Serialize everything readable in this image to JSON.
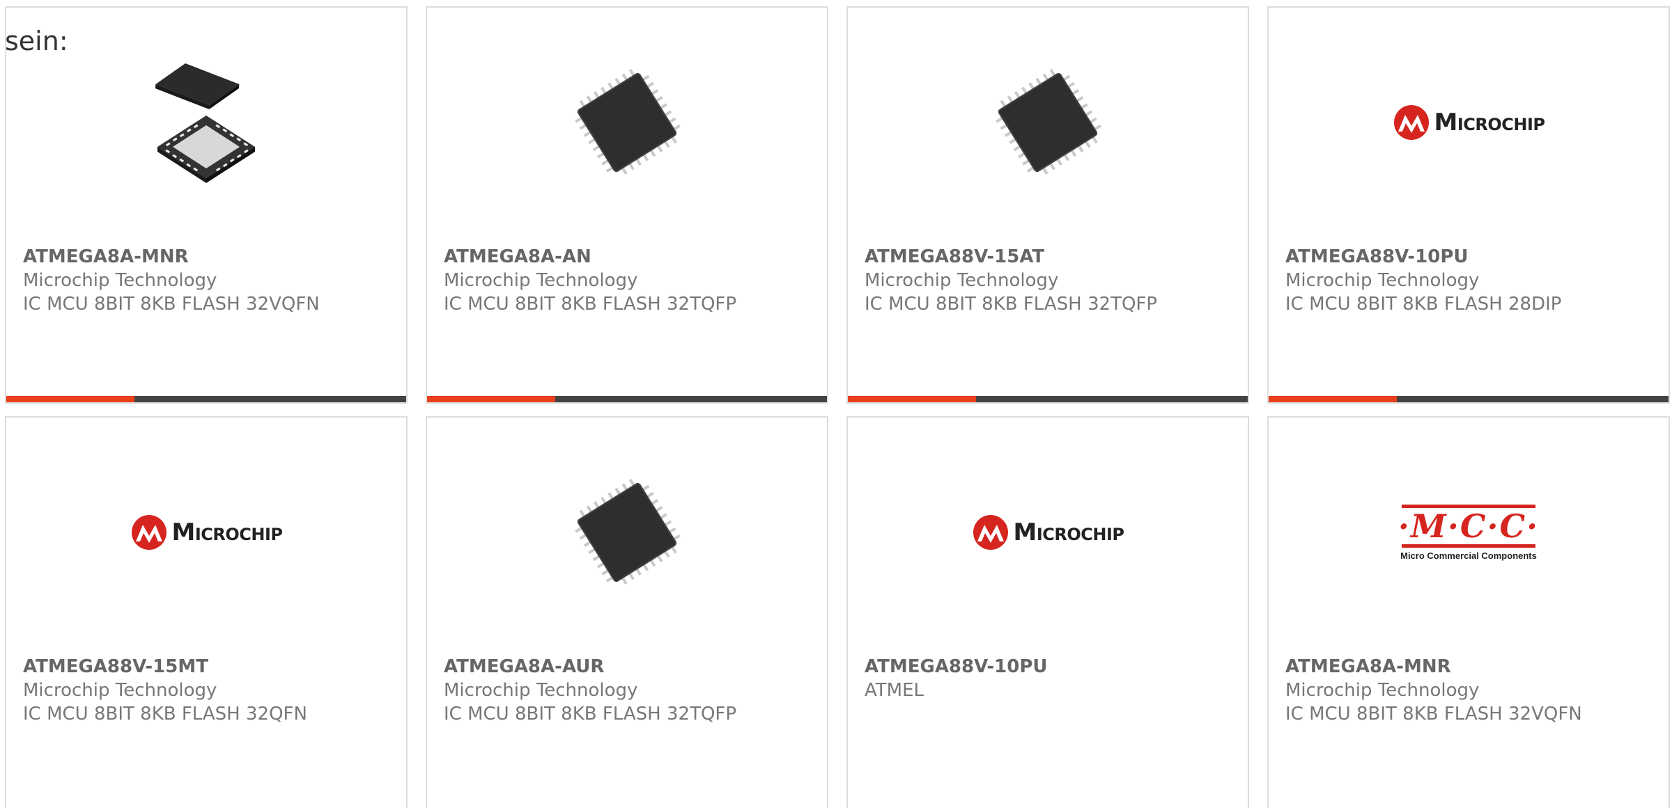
{
  "intro_text": "sein:",
  "colors": {
    "accent": "#e8401c",
    "bar": "#444444",
    "microchip_red": "#d6241e",
    "border": "#dddddd"
  },
  "products": [
    {
      "part": "ATMEGA8A-MNR",
      "manufacturer": "Microchip Technology",
      "description": "IC MCU 8BIT 8KB FLASH 32VQFN",
      "image": "qfn-chip-pair"
    },
    {
      "part": "ATMEGA8A-AN",
      "manufacturer": "Microchip Technology",
      "description": "IC MCU 8BIT 8KB FLASH 32TQFP",
      "image": "tqfp-chip"
    },
    {
      "part": "ATMEGA88V-15AT",
      "manufacturer": "Microchip Technology",
      "description": "IC MCU 8BIT 8KB FLASH 32TQFP",
      "image": "tqfp-chip"
    },
    {
      "part": "ATMEGA88V-10PU",
      "manufacturer": "Microchip Technology",
      "description": "IC MCU 8BIT 8KB FLASH 28DIP",
      "image": "microchip-logo",
      "logo_text": "Microchip"
    },
    {
      "part": "ATMEGA88V-15MT",
      "manufacturer": "Microchip Technology",
      "description": "IC MCU 8BIT 8KB FLASH 32QFN",
      "image": "microchip-logo",
      "logo_text": "Microchip"
    },
    {
      "part": "ATMEGA8A-AUR",
      "manufacturer": "Microchip Technology",
      "description": "IC MCU 8BIT 8KB FLASH 32TQFP",
      "image": "tqfp-chip"
    },
    {
      "part": "ATMEGA88V-10PU",
      "manufacturer": "ATMEL",
      "description": "",
      "image": "microchip-logo",
      "logo_text": "Microchip"
    },
    {
      "part": "ATMEGA8A-MNR",
      "manufacturer": "Microchip Technology",
      "description": "IC MCU 8BIT 8KB FLASH 32VQFN",
      "image": "mcc-logo",
      "logo_text": "·M·C·C·",
      "logo_subtext": "Micro Commercial Components"
    }
  ]
}
